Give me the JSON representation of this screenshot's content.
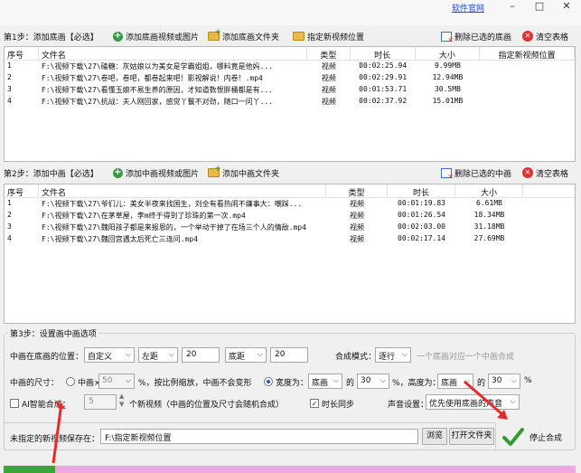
{
  "titlebar": {
    "link": "软件官网",
    "min": "–",
    "max": "□",
    "close": "✕"
  },
  "step1": {
    "label": "第1步：添加底画【必选】",
    "add_video": "添加底画视频或图片",
    "add_folder": "添加底画文件夹",
    "set_location": "指定新视频位置",
    "delete_selected": "删除已选的底画",
    "clear_table": "清空表格",
    "columns": [
      "序号",
      "文件名",
      "类型",
      "时长",
      "大小",
      "指定新视频位置"
    ],
    "rows": [
      [
        "1",
        "F:\\视频下载\\27\\磕糖：灰姑娘以为美女是学霸姐姐，哪料竟是他妈...",
        "视频",
        "00:02:25.94",
        "9.99MB",
        ""
      ],
      [
        "2",
        "F:\\视频下载\\27\\卷吧，卷吧，都卷起来吧！影视解说！内卷！.mp4",
        "视频",
        "00:02:29.91",
        "12.94MB",
        ""
      ],
      [
        "3",
        "F:\\视频下载\\27\\看懂玉娘不易生养的原因，才知道数恨胖桶都是有...",
        "视频",
        "00:01:53.71",
        "30.5MB",
        ""
      ],
      [
        "4",
        "F:\\视频下载\\27\\抗战：夫人刚回家，感觉丫鬟不对劲，随口一问丫...",
        "视频",
        "00:02:37.92",
        "15.01MB",
        ""
      ]
    ]
  },
  "step2": {
    "label": "第2步：添加中画【必选】",
    "add_video": "添加中画视频或图片",
    "add_folder": "添加中画文件夹",
    "delete_selected": "删除已选的中画",
    "clear_table": "清空表格",
    "columns": [
      "序号",
      "文件名",
      "类型",
      "时长",
      "大小"
    ],
    "rows": [
      [
        "1",
        "F:\\视频下载\\27\\爷们儿：美女半夜来找国生，刘全有看热闹不嫌事大：嘲踩...",
        "视频",
        "00:01:19.83",
        "6.61MB"
      ],
      [
        "2",
        "F:\\视频下载\\27\\在茅草屋，李m终于得到了珍珠的第一次.mp4",
        "视频",
        "00:01:26.54",
        "18.34MB"
      ],
      [
        "3",
        "F:\\视频下载\\27\\魏阳孩子都是来报恩的，一个举动干掉了在场三个人的情敌.mp4",
        "视频",
        "00:02:03.00",
        "31.18MB"
      ],
      [
        "4",
        "F:\\视频下载\\27\\魏回宫遇太后死亡三连问.mp4",
        "视频",
        "00:02:17.14",
        "27.69MB"
      ]
    ]
  },
  "step3": {
    "legend": "第3步：设置画中画选项",
    "pos_label": "中画在底画的位置：",
    "pos_mode": "自定义",
    "h_anchor": "左距",
    "h_value": "20",
    "v_anchor": "底距",
    "v_value": "20",
    "blend_label": "合成模式：",
    "blend_mode": "逐行",
    "blend_hint": "一个底画对应一个中画合成",
    "size_label": "中画的尺寸：",
    "percent_label": "中画×",
    "percent_value": "50",
    "percent_unit": "%，按比例缩放，中画不会变形",
    "width_label": "宽度为：",
    "width_ref": "底画",
    "of1": "的",
    "width_value": "30",
    "pct1": "%，高度为：",
    "height_ref": "底画",
    "of2": "的",
    "height_value": "30",
    "pct2": "%",
    "ai_label": "AI智能合成：",
    "ai_value": "5",
    "ai_hint": "个新视频（中画的位置及尺寸会随机合成）",
    "sync_label": "时长同步",
    "sound_label": "声音设置：",
    "sound_value": "优先使用底画的声音"
  },
  "save": {
    "label": "未指定的新视频保存在：",
    "path": "F:\\指定新视频位置",
    "browse": "浏览",
    "open_folder": "打开文件夹"
  },
  "action": {
    "stop": "停止合成"
  },
  "progress": {
    "fraction": 0.09
  },
  "colors": {
    "accent_green": "#2e9e3e",
    "progress_fill": "#3aa53a",
    "progress_bg": "#f1a7e0",
    "link": "#1a4fd6"
  }
}
